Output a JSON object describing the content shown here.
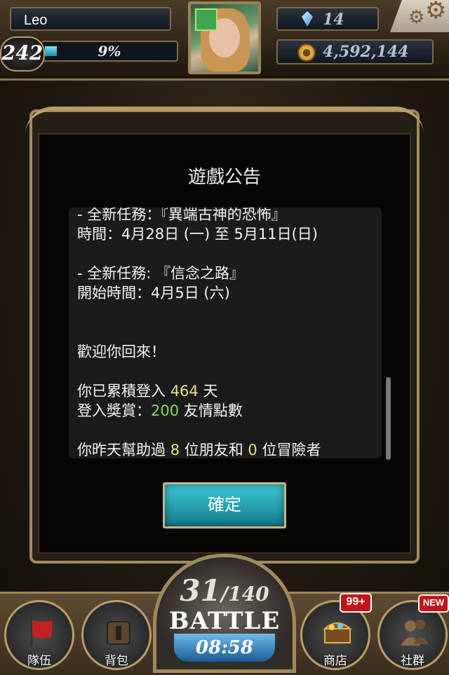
{
  "player": {
    "name": "Leo",
    "level": "242",
    "exp_percent_text": "9%",
    "exp_fraction": 0.09,
    "gems": "14",
    "coins": "4,592,144"
  },
  "dialog": {
    "title": "遊戲公告",
    "lines": [
      "- 全新任務：『異端古神的恐怖』",
      "時間：4月28日 (一) 至 5月11日(日)",
      "- 全新任務: 『信念之路』",
      "開始時間：4月5日 (六)",
      "歡迎你回來！"
    ],
    "login_prefix": "你已累積登入 ",
    "login_days": "464",
    "login_suffix": " 天",
    "reward_prefix": "登入獎賞：",
    "reward_points": "200",
    "reward_suffix": " 友情點數",
    "help_prefix": "你昨天幫助過 ",
    "help_friends": "8",
    "help_mid": " 位朋友和 ",
    "help_adventurers": "0",
    "help_suffix": " 位冒險者",
    "confirm_label": "確定"
  },
  "battle": {
    "current": "31",
    "max": "/140",
    "label": "BATTLE",
    "timer": "08:58"
  },
  "nav": {
    "team": "隊伍",
    "bag": "背包",
    "shop": "商店",
    "social": "社群",
    "shop_badge": "99+",
    "social_badge": "NEW"
  },
  "colors": {
    "highlight_yellow": "#e8e07a",
    "highlight_green": "#87d957",
    "confirm_button": "#2aa6b6",
    "badge_red": "#c4131c"
  }
}
